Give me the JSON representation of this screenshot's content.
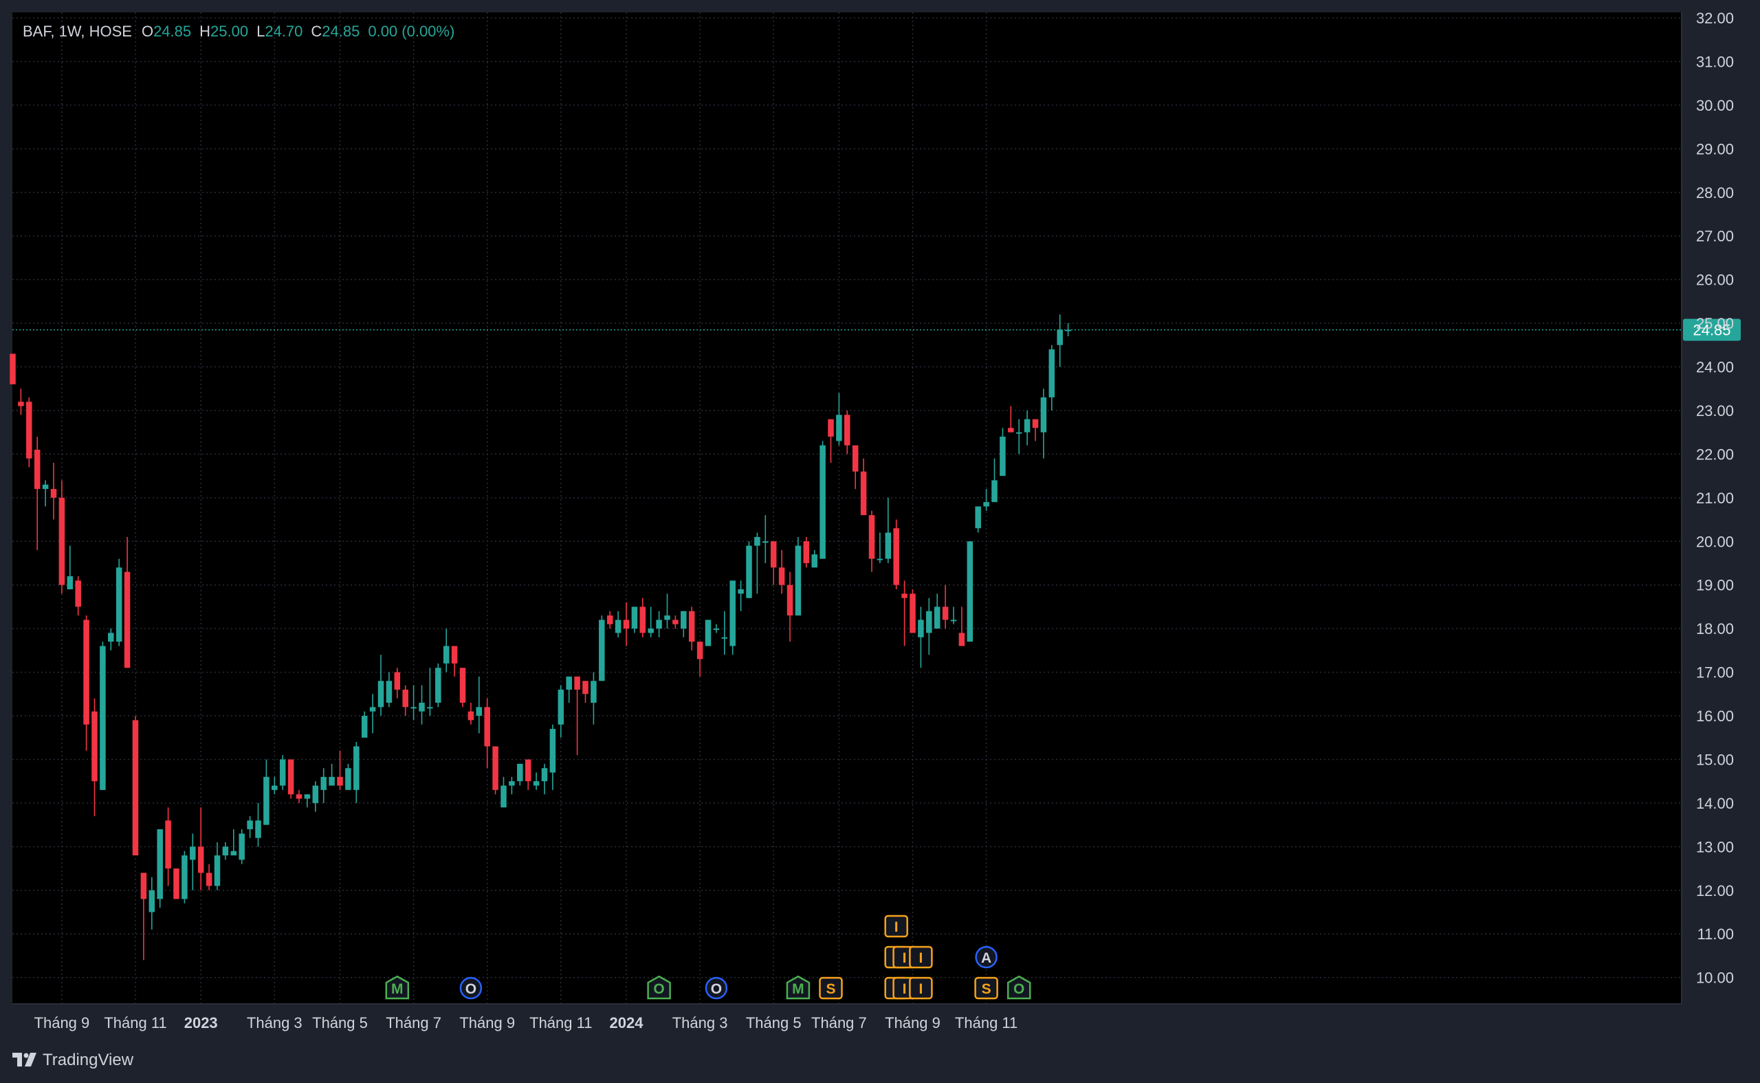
{
  "legend": {
    "symbol": "BAF, 1W, HOSE",
    "o_label": "O",
    "o_value": "24.85",
    "h_label": "H",
    "h_value": "25.00",
    "l_label": "L",
    "l_value": "24.70",
    "c_label": "C",
    "c_value": "24.85",
    "change": "0.00 (0.00%)"
  },
  "brand": {
    "name": "TradingView",
    "icon": "tradingview-logo-icon"
  },
  "colors": {
    "background": "#000000",
    "frame": "#1e222d",
    "grid": "#2a2e39",
    "up": "#26a69a",
    "down": "#f23645",
    "axis_text": "#d1d4dc",
    "price_line": "#26a69a",
    "event_orange": "#f7a21b",
    "event_blue": "#2962ff",
    "event_green": "#4caf50"
  },
  "chart_data": {
    "type": "candlestick",
    "title": "",
    "xlabel": "",
    "ylabel": "",
    "ylim": [
      9.6,
      32.0
    ],
    "y_ticks": [
      "10.00",
      "11.00",
      "12.00",
      "13.00",
      "14.00",
      "15.00",
      "16.00",
      "17.00",
      "18.00",
      "19.00",
      "20.00",
      "21.00",
      "22.00",
      "23.00",
      "24.00",
      "25.00",
      "26.00",
      "27.00",
      "28.00",
      "29.00",
      "30.00",
      "31.00",
      "32.00"
    ],
    "x_ticks": [
      {
        "label": "Tháng 9",
        "bold": false
      },
      {
        "label": "Tháng 11",
        "bold": false
      },
      {
        "label": "2023",
        "bold": true
      },
      {
        "label": "Tháng 3",
        "bold": false
      },
      {
        "label": "Tháng 5",
        "bold": false
      },
      {
        "label": "Tháng 7",
        "bold": false
      },
      {
        "label": "Tháng 9",
        "bold": false
      },
      {
        "label": "Tháng 11",
        "bold": false
      },
      {
        "label": "2024",
        "bold": true
      },
      {
        "label": "Tháng 3",
        "bold": false
      },
      {
        "label": "Tháng 5",
        "bold": false
      },
      {
        "label": "Tháng 7",
        "bold": false
      },
      {
        "label": "Tháng 9",
        "bold": false
      },
      {
        "label": "Tháng 11",
        "bold": false
      }
    ],
    "x_tick_bar_index": [
      6,
      15,
      23,
      32,
      40,
      49,
      58,
      67,
      75,
      84,
      93,
      101,
      110,
      119
    ],
    "last_price": "24.85",
    "grid": true,
    "ohlc": [
      [
        24.3,
        24.3,
        23.6,
        23.6
      ],
      [
        23.2,
        23.5,
        22.9,
        23.1
      ],
      [
        23.2,
        23.3,
        21.7,
        21.9
      ],
      [
        22.1,
        22.4,
        19.8,
        21.2
      ],
      [
        21.2,
        21.4,
        20.8,
        21.3
      ],
      [
        21.2,
        21.8,
        20.5,
        21.0
      ],
      [
        21.0,
        21.4,
        18.8,
        19.0
      ],
      [
        18.9,
        19.9,
        18.9,
        19.2
      ],
      [
        19.1,
        19.2,
        18.3,
        18.5
      ],
      [
        18.2,
        18.3,
        15.2,
        15.8
      ],
      [
        16.1,
        16.4,
        13.7,
        14.5
      ],
      [
        14.3,
        17.7,
        14.3,
        17.6
      ],
      [
        17.7,
        18.0,
        17.5,
        17.9
      ],
      [
        17.7,
        19.6,
        17.6,
        19.4
      ],
      [
        19.3,
        20.1,
        17.1,
        17.1
      ],
      [
        15.9,
        16.0,
        12.8,
        12.8
      ],
      [
        12.4,
        12.4,
        10.4,
        11.8
      ],
      [
        11.5,
        12.3,
        11.1,
        12.0
      ],
      [
        11.8,
        13.4,
        11.6,
        13.4
      ],
      [
        13.6,
        13.9,
        12.1,
        12.5
      ],
      [
        12.5,
        12.5,
        11.8,
        11.8
      ],
      [
        11.8,
        12.9,
        11.7,
        12.8
      ],
      [
        12.7,
        13.3,
        12.0,
        13.0
      ],
      [
        13.0,
        13.9,
        12.0,
        12.4
      ],
      [
        12.4,
        12.6,
        12.0,
        12.1
      ],
      [
        12.1,
        13.1,
        12.0,
        12.8
      ],
      [
        12.8,
        13.1,
        12.7,
        13.0
      ],
      [
        12.8,
        13.4,
        12.8,
        12.9
      ],
      [
        12.7,
        13.4,
        12.6,
        13.3
      ],
      [
        13.4,
        13.7,
        13.2,
        13.6
      ],
      [
        13.2,
        14.0,
        13.0,
        13.6
      ],
      [
        13.5,
        15.0,
        13.5,
        14.6
      ],
      [
        14.3,
        14.6,
        14.2,
        14.4
      ],
      [
        14.4,
        15.1,
        14.3,
        15.0
      ],
      [
        15.0,
        15.0,
        14.1,
        14.2
      ],
      [
        14.2,
        14.3,
        14.0,
        14.1
      ],
      [
        14.1,
        14.2,
        13.9,
        14.2
      ],
      [
        14.0,
        14.5,
        13.8,
        14.4
      ],
      [
        14.3,
        14.8,
        14.0,
        14.6
      ],
      [
        14.4,
        14.9,
        14.4,
        14.6
      ],
      [
        14.6,
        15.2,
        14.3,
        14.4
      ],
      [
        14.3,
        14.9,
        14.3,
        14.8
      ],
      [
        14.3,
        15.4,
        14.0,
        15.3
      ],
      [
        15.5,
        16.1,
        15.5,
        16.0
      ],
      [
        16.1,
        16.5,
        15.6,
        16.2
      ],
      [
        16.2,
        17.4,
        16.0,
        16.8
      ],
      [
        16.3,
        17.0,
        16.2,
        16.8
      ],
      [
        17.0,
        17.1,
        16.4,
        16.6
      ],
      [
        16.6,
        16.7,
        16.0,
        16.2
      ],
      [
        16.2,
        16.7,
        15.9,
        16.2
      ],
      [
        16.1,
        16.7,
        15.8,
        16.3
      ],
      [
        16.2,
        17.1,
        16.0,
        16.2
      ],
      [
        16.3,
        17.2,
        16.2,
        17.1
      ],
      [
        17.2,
        18.0,
        17.0,
        17.6
      ],
      [
        17.6,
        17.6,
        16.9,
        17.2
      ],
      [
        17.1,
        17.1,
        16.2,
        16.3
      ],
      [
        16.1,
        16.3,
        15.8,
        15.9
      ],
      [
        16.0,
        16.9,
        15.6,
        16.2
      ],
      [
        16.2,
        16.4,
        14.8,
        15.3
      ],
      [
        15.3,
        15.3,
        14.2,
        14.3
      ],
      [
        13.9,
        14.6,
        13.9,
        14.4
      ],
      [
        14.4,
        14.6,
        14.2,
        14.5
      ],
      [
        14.5,
        14.9,
        14.4,
        14.9
      ],
      [
        15.0,
        15.0,
        14.3,
        14.5
      ],
      [
        14.4,
        14.7,
        14.3,
        14.5
      ],
      [
        14.5,
        14.9,
        14.2,
        14.8
      ],
      [
        14.7,
        15.8,
        14.3,
        15.7
      ],
      [
        15.8,
        16.7,
        15.5,
        16.6
      ],
      [
        16.6,
        16.9,
        16.3,
        16.9
      ],
      [
        16.9,
        16.9,
        15.1,
        16.6
      ],
      [
        16.8,
        16.8,
        16.3,
        16.5
      ],
      [
        16.3,
        17.0,
        15.8,
        16.8
      ],
      [
        16.8,
        18.3,
        16.8,
        18.2
      ],
      [
        18.3,
        18.4,
        18.0,
        18.1
      ],
      [
        17.9,
        18.4,
        17.8,
        18.2
      ],
      [
        18.2,
        18.6,
        17.6,
        18.0
      ],
      [
        18.0,
        18.5,
        17.9,
        18.5
      ],
      [
        18.5,
        18.7,
        17.8,
        17.9
      ],
      [
        17.9,
        18.5,
        17.8,
        18.0
      ],
      [
        18.0,
        18.4,
        17.8,
        18.2
      ],
      [
        18.2,
        18.8,
        18.0,
        18.3
      ],
      [
        18.2,
        18.3,
        18.0,
        18.1
      ],
      [
        18.0,
        18.4,
        17.8,
        18.4
      ],
      [
        18.4,
        18.5,
        17.5,
        17.7
      ],
      [
        17.7,
        17.7,
        16.9,
        17.3
      ],
      [
        17.6,
        18.2,
        17.6,
        18.2
      ],
      [
        18.0,
        18.1,
        17.9,
        18.0
      ],
      [
        17.8,
        18.4,
        17.4,
        17.8
      ],
      [
        17.6,
        19.0,
        17.4,
        19.1
      ],
      [
        18.8,
        19.1,
        18.4,
        18.9
      ],
      [
        18.7,
        20.0,
        18.7,
        19.9
      ],
      [
        19.9,
        20.2,
        18.8,
        20.1
      ],
      [
        20.0,
        20.6,
        19.5,
        20.0
      ],
      [
        20.0,
        20.0,
        19.0,
        19.4
      ],
      [
        19.4,
        19.8,
        18.8,
        19.0
      ],
      [
        19.0,
        19.3,
        17.7,
        18.3
      ],
      [
        18.3,
        20.1,
        18.3,
        19.9
      ],
      [
        20.0,
        20.1,
        19.4,
        19.5
      ],
      [
        19.4,
        19.8,
        19.4,
        19.7
      ],
      [
        19.6,
        22.3,
        19.6,
        22.2
      ],
      [
        22.8,
        22.8,
        21.8,
        22.4
      ],
      [
        22.3,
        23.4,
        22.2,
        22.9
      ],
      [
        22.9,
        23.0,
        22.0,
        22.2
      ],
      [
        22.2,
        22.2,
        21.2,
        21.6
      ],
      [
        21.6,
        21.9,
        21.0,
        20.6
      ],
      [
        20.6,
        20.7,
        19.3,
        19.6
      ],
      [
        19.6,
        20.2,
        19.5,
        19.6
      ],
      [
        19.6,
        21.0,
        19.5,
        20.2
      ],
      [
        20.3,
        20.5,
        18.9,
        19.0
      ],
      [
        18.8,
        19.1,
        17.6,
        18.7
      ],
      [
        18.8,
        18.9,
        18.0,
        17.9
      ],
      [
        17.8,
        18.5,
        17.1,
        18.2
      ],
      [
        17.9,
        18.7,
        17.4,
        18.4
      ],
      [
        18.0,
        18.8,
        18.0,
        18.5
      ],
      [
        18.5,
        19.0,
        18.0,
        18.2
      ],
      [
        18.2,
        18.5,
        18.1,
        18.2
      ],
      [
        17.9,
        18.5,
        17.6,
        17.6
      ],
      [
        17.7,
        20.0,
        17.7,
        20.0
      ],
      [
        20.3,
        20.8,
        20.2,
        20.8
      ],
      [
        20.8,
        21.2,
        20.7,
        20.9
      ],
      [
        20.9,
        21.9,
        20.9,
        21.4
      ],
      [
        21.5,
        22.6,
        21.5,
        22.4
      ],
      [
        22.6,
        23.1,
        22.5,
        22.5
      ],
      [
        22.5,
        22.8,
        22.0,
        22.5
      ],
      [
        22.5,
        23.0,
        22.2,
        22.8
      ],
      [
        22.8,
        22.8,
        22.3,
        22.6
      ],
      [
        22.5,
        23.5,
        21.9,
        23.3
      ],
      [
        23.3,
        24.5,
        23.0,
        24.4
      ],
      [
        24.5,
        25.2,
        24.0,
        24.85
      ],
      [
        24.85,
        25.0,
        24.7,
        24.85
      ]
    ],
    "events": [
      {
        "bar": 47,
        "type": "shield",
        "letter": "M",
        "row": 0,
        "color": "green"
      },
      {
        "bar": 56,
        "type": "circle",
        "letter": "O",
        "row": 0,
        "color": "blue"
      },
      {
        "bar": 79,
        "type": "shield",
        "letter": "O",
        "row": 0,
        "color": "green"
      },
      {
        "bar": 86,
        "type": "circle",
        "letter": "O",
        "row": 0,
        "color": "blue"
      },
      {
        "bar": 96,
        "type": "shield",
        "letter": "M",
        "row": 0,
        "color": "green"
      },
      {
        "bar": 100,
        "type": "square",
        "letter": "S",
        "row": 0,
        "color": "orange"
      },
      {
        "bar": 108,
        "type": "square",
        "letter": "I",
        "row": 0,
        "color": "orange"
      },
      {
        "bar": 108,
        "type": "square",
        "letter": "I",
        "row": 1,
        "color": "orange"
      },
      {
        "bar": 108,
        "type": "square",
        "letter": "I",
        "row": 2,
        "color": "orange"
      },
      {
        "bar": 109,
        "type": "square",
        "letter": "I",
        "row": 0,
        "color": "orange"
      },
      {
        "bar": 109,
        "type": "square",
        "letter": "I",
        "row": 1,
        "color": "orange"
      },
      {
        "bar": 111,
        "type": "square",
        "letter": "I",
        "row": 0,
        "color": "orange"
      },
      {
        "bar": 111,
        "type": "square",
        "letter": "I",
        "row": 1,
        "color": "orange"
      },
      {
        "bar": 119,
        "type": "square",
        "letter": "S",
        "row": 0,
        "color": "orange"
      },
      {
        "bar": 119,
        "type": "circle",
        "letter": "A",
        "row": 1,
        "color": "blue"
      },
      {
        "bar": 123,
        "type": "shield",
        "letter": "O",
        "row": 0,
        "color": "green"
      }
    ]
  }
}
